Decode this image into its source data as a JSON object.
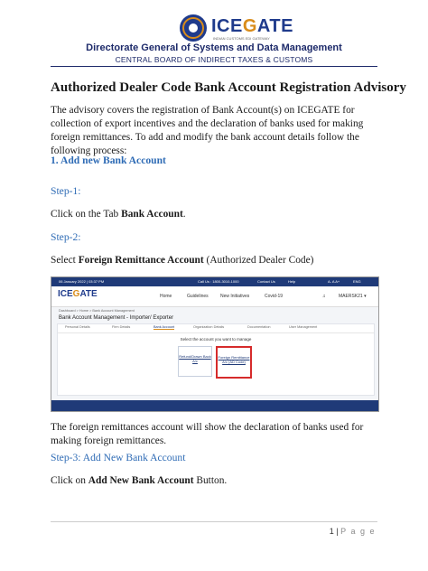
{
  "header": {
    "logo_left": "ICE",
    "logo_mid": "G",
    "logo_right": "ATE",
    "logo_tagline": "INDIAN CUSTOMS EDI GATEWAY",
    "department": "Directorate General of Systems and Data Management",
    "board": "CENTRAL BOARD OF INDIRECT TAXES & CUSTOMS"
  },
  "document": {
    "title": "Authorized Dealer Code Bank Account Registration Advisory",
    "intro": "The advisory covers the registration of Bank Account(s) on ICEGATE for collection of export incentives and the declaration of banks used for making foreign remittances. To add and modify the bank account details follow the following process:",
    "section1": "1.  Add new Bank Account",
    "step1_label": "Step-1:",
    "step1_pre": "Click on the Tab ",
    "step1_bold": "Bank Account",
    "step1_post": ".",
    "step2_label": "Step-2:",
    "step2_pre": "Select ",
    "step2_bold": "Foreign Remittance Account",
    "step2_post": " (Authorized Dealer Code)",
    "foreign_note": "The foreign remittances account will show the declaration of banks used for making foreign remittances.",
    "step3_label": "Step-3: Add New Bank Account",
    "step3_pre": "Click on ",
    "step3_bold": "Add New Bank Account",
    "step3_post": " Button."
  },
  "screenshot": {
    "topbar_date": "06 January 2022 | 03:37 PM",
    "topbar_call": "Call Us : 1800-3010-1000",
    "topbar_contact": "Contact Us",
    "topbar_help": "Help",
    "topbar_font": "A-  A  A+",
    "topbar_lang": "ENG",
    "logo_left": "ICE",
    "logo_mid": "G",
    "logo_right": "ATE",
    "nav": [
      "Home",
      "Guidelines",
      "New Initiatives",
      "Covid-19"
    ],
    "user": "MAERSK21 ▾",
    "breadcrumb": "Dashboard  >  Home  >  Bank Account Management",
    "page_title": "Bank Account Management - Importer/ Exporter",
    "tabs": [
      "Personal Details",
      "Firm Details",
      "Bank Account",
      "Organization Details",
      "Documentation",
      "User Management"
    ],
    "prompt": "Select the account you want to manage",
    "card_refund": "Refund/Drawn Back A/c",
    "card_foreign": "Foreign Remittance A/c (AD Code)"
  },
  "footer": {
    "page_number": "1",
    "separator": " | ",
    "page_word": "P a g e"
  }
}
